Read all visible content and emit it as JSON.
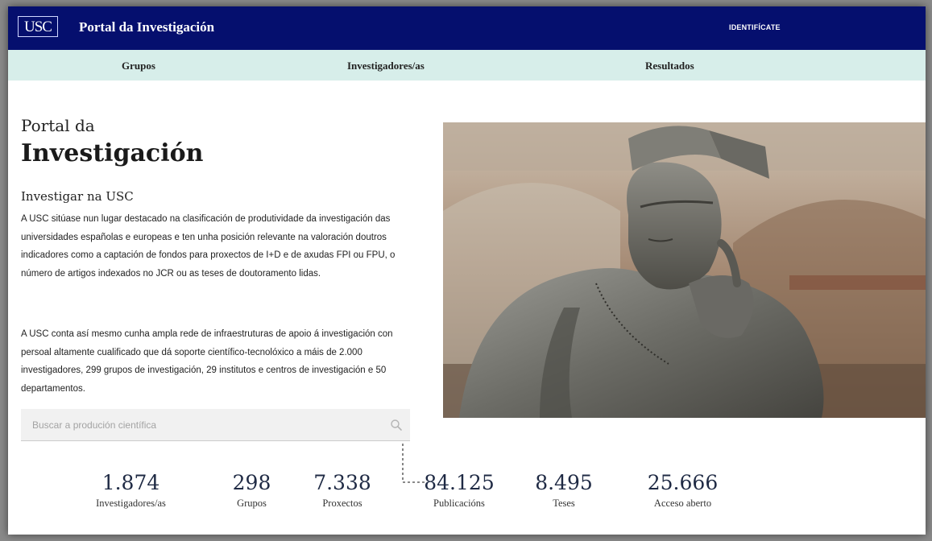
{
  "header": {
    "logo_text": "USC",
    "site_title": "Portal da Investigación",
    "login_label": "IDENTIFÍCATE",
    "bg_color": "#050f6e"
  },
  "nav": {
    "items": [
      {
        "label": "Grupos"
      },
      {
        "label": "Investigadores/as"
      },
      {
        "label": "Resultados"
      }
    ],
    "bg_color": "#d7eeea"
  },
  "hero": {
    "kicker": "Portal da",
    "title": "Investigación",
    "section_title": "Investigar na USC",
    "paragraph1": "A USC sitúase nun lugar destacado na clasificación de produtividade da investigación das universidades españolas e europeas e ten unha posición relevante na valoración doutros indicadores como a captación de fondos para proxectos de I+D e de axudas FPI ou FPU, o número de artigos indexados no JCR ou as teses de doutoramento lidas.",
    "paragraph2": "A USC conta así mesmo cunha ampla rede de infraestruturas de apoio á investigación con persoal altamente cualificado que dá soporte científico-tecnolóxico a máis de 2.000 investigadores, 299 grupos de investigación, 29 institutos e centros de investigación e 50 departamentos."
  },
  "search": {
    "placeholder": "Buscar a produción científica",
    "icon": "search-icon"
  },
  "stats": [
    {
      "value": "1.874",
      "label": "Investigadores/as"
    },
    {
      "value": "298",
      "label": "Grupos"
    },
    {
      "value": "7.338",
      "label": "Proxectos"
    },
    {
      "value": "84.125",
      "label": "Publicacións"
    },
    {
      "value": "8.495",
      "label": "Teses"
    },
    {
      "value": "25.666",
      "label": "Acceso aberto"
    }
  ]
}
